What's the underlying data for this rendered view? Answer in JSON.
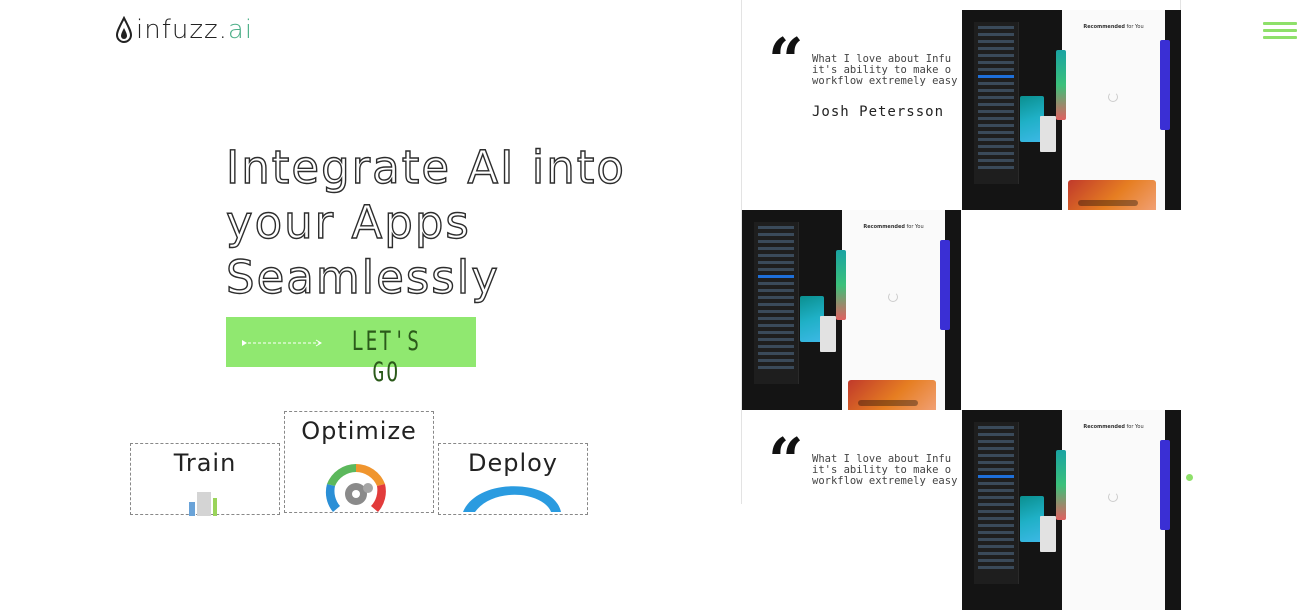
{
  "brand": {
    "name_main": "infuzz.",
    "name_suffix": "ai",
    "accent": "#4caf88"
  },
  "hero": {
    "title_lines": [
      "Integrate AI into",
      "your Apps",
      "Seamlessly"
    ],
    "cta_label": "LET'S GO",
    "cta_color": "#90e870"
  },
  "steps": [
    {
      "label": "Train",
      "icon": "train-icon"
    },
    {
      "label": "Optimize",
      "icon": "optimize-gears-icon"
    },
    {
      "label": "Deploy",
      "icon": "deploy-wave-icon"
    }
  ],
  "testimonials": [
    {
      "quote": "What I love about Infu\nit's ability to make o\nworkflow extremely easy",
      "author": "Josh Petersson"
    },
    {
      "quote": "What I love about Infu\nit's ability to make o\nworkflow extremely easy",
      "author": ""
    }
  ],
  "app_preview": {
    "panel_title_bold": "Recommended",
    "panel_title_rest": " for You"
  },
  "menu_icon": "hamburger-menu-icon"
}
